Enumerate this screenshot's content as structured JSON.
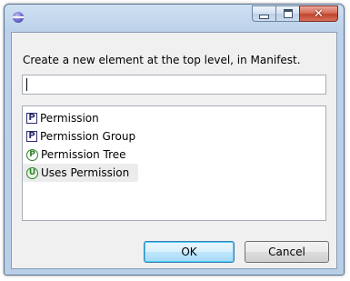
{
  "window": {
    "close_glyph": "✕",
    "icon": "eclipse-icon"
  },
  "dialog": {
    "message": "Create a new element at the top level, in Manifest.",
    "filter": {
      "value": "",
      "placeholder": ""
    },
    "items": [
      {
        "badge": "P",
        "badge_shape": "square",
        "label": "Permission",
        "selected": false
      },
      {
        "badge": "P",
        "badge_shape": "square",
        "label": "Permission Group",
        "selected": false
      },
      {
        "badge": "P",
        "badge_shape": "circle",
        "label": "Permission Tree",
        "selected": false
      },
      {
        "badge": "U",
        "badge_shape": "circle",
        "label": "Uses Permission",
        "selected": true
      }
    ],
    "buttons": {
      "ok": "OK",
      "cancel": "Cancel"
    }
  },
  "colors": {
    "title_bar": "#bcd2ea",
    "client_bg": "#f0f0f0",
    "close_button": "#c0452b",
    "default_button_border": "#3c7fb1",
    "badge_square": "#2b2b6b",
    "badge_circle": "#2d7f2d"
  }
}
